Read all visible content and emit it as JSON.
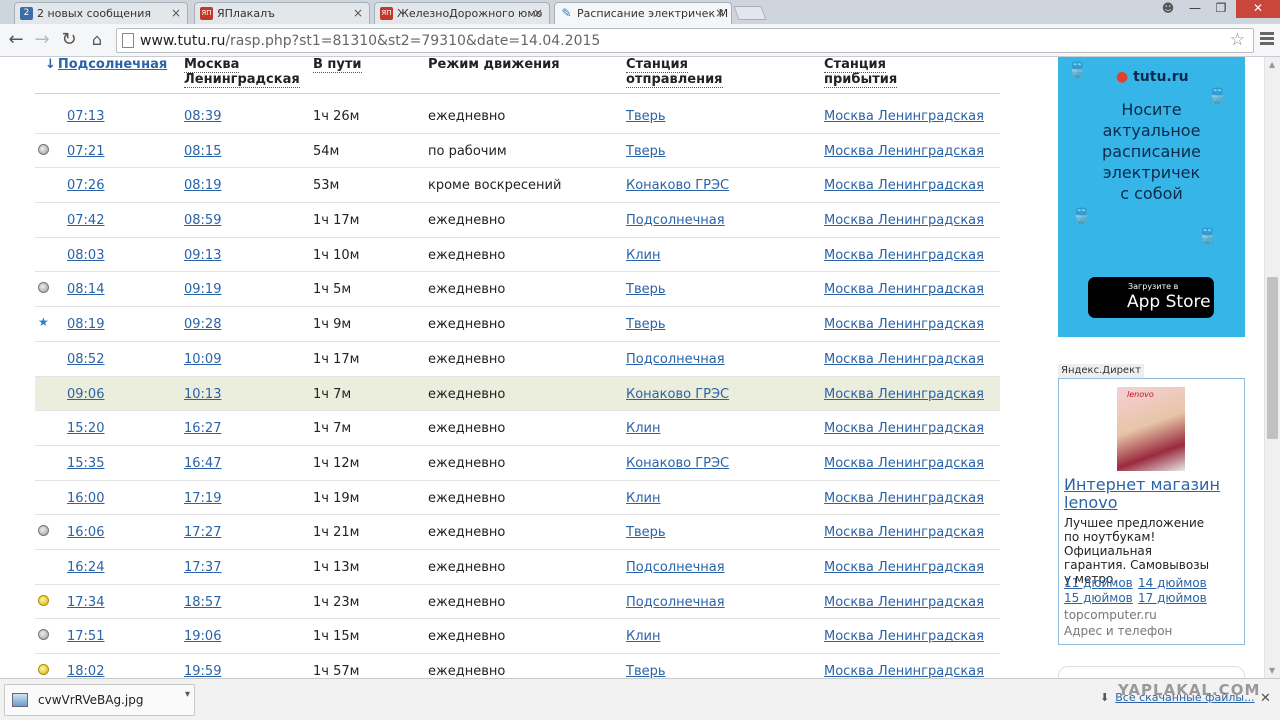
{
  "browser": {
    "tabs": [
      {
        "title": "2 новых сообщения",
        "favicon": "2",
        "favicon_color": "#3a6ea5"
      },
      {
        "title": "ЯПлакалъ",
        "favicon": "ЯП",
        "favicon_color": "#c0392b"
      },
      {
        "title": "ЖелезноДорожного юмо",
        "favicon": "ЯП",
        "favicon_color": "#c0392b"
      },
      {
        "title": "Расписание электричек М",
        "favicon": "tutu-icon",
        "favicon_color": "#2a7fc8",
        "active": true
      }
    ],
    "url_host": "www.tutu.ru",
    "url_path": "/rasp.php?st1=81310&st2=79310&date=14.04.2015"
  },
  "schedule": {
    "headers": {
      "departure": "Подсолнечная",
      "arrival_l1": "Москва",
      "arrival_l2": "Ленинградская",
      "duration": "В пути",
      "mode": "Режим движения",
      "from_l1": "Станция",
      "from_l2": "отправления",
      "to_l1": "Станция",
      "to_l2": "прибытия"
    },
    "rows": [
      {
        "marker": "",
        "dep": "07:13",
        "arr": "08:39",
        "dur": "1ч 26м",
        "mode": "ежедневно",
        "from": "Тверь",
        "to": "Москва Ленинградская"
      },
      {
        "marker": "gray",
        "dep": "07:21",
        "arr": "08:15",
        "dur": "54м",
        "mode": "по рабочим",
        "from": "Тверь",
        "to": "Москва Ленинградская"
      },
      {
        "marker": "",
        "dep": "07:26",
        "arr": "08:19",
        "dur": "53м",
        "mode": "кроме воскресений",
        "from": "Конаково ГРЭС",
        "to": "Москва Ленинградская"
      },
      {
        "marker": "",
        "dep": "07:42",
        "arr": "08:59",
        "dur": "1ч 17м",
        "mode": "ежедневно",
        "from": "Подсолнечная",
        "to": "Москва Ленинградская"
      },
      {
        "marker": "",
        "dep": "08:03",
        "arr": "09:13",
        "dur": "1ч 10м",
        "mode": "ежедневно",
        "from": "Клин",
        "to": "Москва Ленинградская"
      },
      {
        "marker": "gray",
        "dep": "08:14",
        "arr": "09:19",
        "dur": "1ч 5м",
        "mode": "ежедневно",
        "from": "Тверь",
        "to": "Москва Ленинградская"
      },
      {
        "marker": "star",
        "dep": "08:19",
        "arr": "09:28",
        "dur": "1ч 9м",
        "mode": "ежедневно",
        "from": "Тверь",
        "to": "Москва Ленинградская"
      },
      {
        "marker": "",
        "dep": "08:52",
        "arr": "10:09",
        "dur": "1ч 17м",
        "mode": "ежедневно",
        "from": "Подсолнечная",
        "to": "Москва Ленинградская"
      },
      {
        "marker": "",
        "dep": "09:06",
        "arr": "10:13",
        "dur": "1ч 7м",
        "mode": "ежедневно",
        "from": "Конаково ГРЭС",
        "to": "Москва Ленинградская",
        "highlight": true
      },
      {
        "marker": "",
        "dep": "15:20",
        "arr": "16:27",
        "dur": "1ч 7м",
        "mode": "ежедневно",
        "from": "Клин",
        "to": "Москва Ленинградская"
      },
      {
        "marker": "",
        "dep": "15:35",
        "arr": "16:47",
        "dur": "1ч 12м",
        "mode": "ежедневно",
        "from": "Конаково ГРЭС",
        "to": "Москва Ленинградская"
      },
      {
        "marker": "",
        "dep": "16:00",
        "arr": "17:19",
        "dur": "1ч 19м",
        "mode": "ежедневно",
        "from": "Клин",
        "to": "Москва Ленинградская"
      },
      {
        "marker": "gray",
        "dep": "16:06",
        "arr": "17:27",
        "dur": "1ч 21м",
        "mode": "ежедневно",
        "from": "Тверь",
        "to": "Москва Ленинградская"
      },
      {
        "marker": "",
        "dep": "16:24",
        "arr": "17:37",
        "dur": "1ч 13м",
        "mode": "ежедневно",
        "from": "Подсолнечная",
        "to": "Москва Ленинградская"
      },
      {
        "marker": "yellow",
        "dep": "17:34",
        "arr": "18:57",
        "dur": "1ч 23м",
        "mode": "ежедневно",
        "from": "Подсолнечная",
        "to": "Москва Ленинградская"
      },
      {
        "marker": "gray",
        "dep": "17:51",
        "arr": "19:06",
        "dur": "1ч 15м",
        "mode": "ежедневно",
        "from": "Клин",
        "to": "Москва Ленинградская"
      },
      {
        "marker": "yellow",
        "dep": "18:02",
        "arr": "19:59",
        "dur": "1ч 57м",
        "mode": "ежедневно",
        "from": "Тверь",
        "to": "Москва Ленинградская"
      }
    ]
  },
  "banner": {
    "logo": "tutu.ru",
    "slogan_lines": [
      "Носите",
      "актуальное",
      "расписание",
      "электричек",
      "с собой"
    ],
    "store_small": "Загрузите в",
    "store_big": "App Store"
  },
  "direct": {
    "label": "Яндекс.Директ",
    "product_brand": "lenovo",
    "headline_l1": "Интернет магазин",
    "headline_l2": "lenovo",
    "desc_lines": [
      "Лучшее предложение",
      "по ноутбукам! Официальная",
      "гарантия. Самовывозы",
      "у метро."
    ],
    "links": [
      "11 дюймов",
      "14 дюймов",
      "15 дюймов",
      "17 дюймов"
    ],
    "domain": "topcomputer.ru",
    "address": "Адрес и телефон"
  },
  "download_bar": {
    "file": "cvwVrRVeBAg.jpg",
    "all_label": "Все скачанные файлы...",
    "watermark": "YAPLAKAL.COM"
  },
  "colors": {
    "link": "#2a63a8",
    "highlight_row": "#ebeedd",
    "banner_bg": "#36b6e8"
  }
}
